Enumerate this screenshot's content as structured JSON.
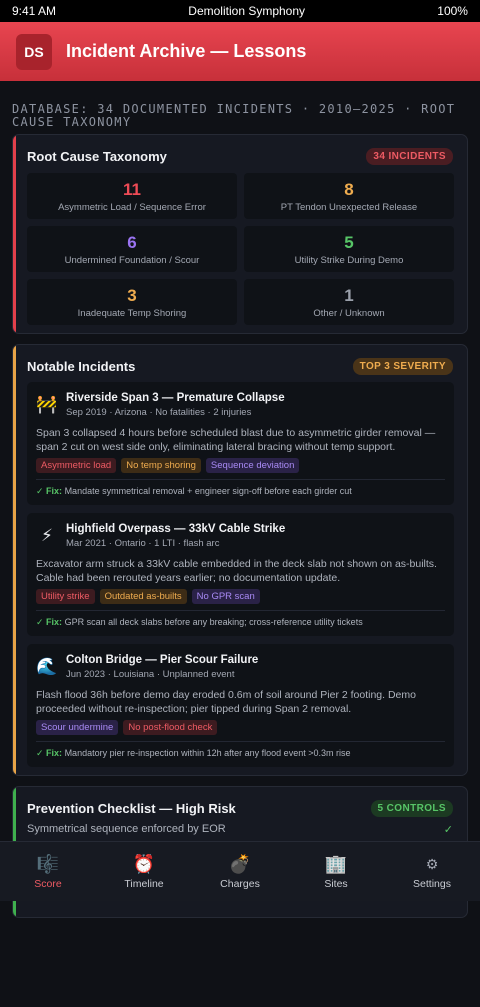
{
  "status_bar": {
    "time": "9:41 AM",
    "title": "Demolition Symphony",
    "battery": "100%"
  },
  "header": {
    "avatar": "DS",
    "title": "Incident Archive — Lessons"
  },
  "database_line": "DATABASE: 34 DOCUMENTED INCIDENTS · 2010–2025 · ROOT CAUSE TAXONOMY",
  "taxonomy": {
    "title": "Root Cause Taxonomy",
    "badge": "34 INCIDENTS",
    "cells": [
      {
        "value": "11",
        "label": "Asymmetric Load / Sequence Error",
        "color": "#ee4b56"
      },
      {
        "value": "8",
        "label": "PT Tendon Unexpected Release",
        "color": "#efac4f"
      },
      {
        "value": "6",
        "label": "Undermined Foundation / Scour",
        "color": "#9a73f2"
      },
      {
        "value": "5",
        "label": "Utility Strike During Demo",
        "color": "#57c567"
      },
      {
        "value": "3",
        "label": "Inadequate Temp Shoring",
        "color": "#efac4f"
      },
      {
        "value": "1",
        "label": "Other / Unknown",
        "color": "#9aa0ab"
      }
    ]
  },
  "notable": {
    "title": "Notable Incidents",
    "badge": "TOP 3 SEVERITY",
    "incidents": [
      {
        "icon": "🚧",
        "icon_name": "construction-barrier-icon",
        "title": "Riverside Span 3 — Premature Collapse",
        "meta": "Sep 2019 · Arizona · No fatalities · 2 injuries",
        "description": "Span 3 collapsed 4 hours before scheduled blast due to asymmetric girder removal — span 2 cut on west side only, eliminating lateral bracing without temp support.",
        "tags": [
          {
            "text": "Asymmetric load",
            "color": "red"
          },
          {
            "text": "No temp shoring",
            "color": "amber"
          },
          {
            "text": "Sequence deviation",
            "color": "purple"
          }
        ],
        "fix_label": "✓ Fix:",
        "fix_text": "Mandate symmetrical removal + engineer sign-off before each girder cut"
      },
      {
        "icon": "⚡",
        "icon_name": "lightning-icon",
        "title": "Highfield Overpass — 33kV Cable Strike",
        "meta": "Mar 2021 · Ontario · 1 LTI · flash arc",
        "description": "Excavator arm struck a 33kV cable embedded in the deck slab not shown on as-builts. Cable had been rerouted years earlier; no documentation update.",
        "tags": [
          {
            "text": "Utility strike",
            "color": "red"
          },
          {
            "text": "Outdated as-builts",
            "color": "amber"
          },
          {
            "text": "No GPR scan",
            "color": "purple"
          }
        ],
        "fix_label": "✓ Fix:",
        "fix_text": "GPR scan all deck slabs before any breaking; cross-reference utility tickets"
      },
      {
        "icon": "🌊",
        "icon_name": "wave-icon",
        "title": "Colton Bridge — Pier Scour Failure",
        "meta": "Jun 2023 · Louisiana · Unplanned event",
        "description": "Flash flood 36h before demo day eroded 0.6m of soil around Pier 2 footing. Demo proceeded without re-inspection; pier tipped during Span 2 removal.",
        "tags": [
          {
            "text": "Scour undermine",
            "color": "purple"
          },
          {
            "text": "No post-flood check",
            "color": "red"
          }
        ],
        "fix_label": "✓ Fix:",
        "fix_text": "Mandatory pier re-inspection within 12h after any flood event >0.3m rise"
      }
    ]
  },
  "checklist": {
    "title": "Prevention Checklist — High Risk",
    "badge": "5 CONTROLS",
    "first_item": "Symmetrical sequence enforced by EOR",
    "first_check": "✓"
  },
  "tabbar": [
    {
      "icon": "🎼",
      "icon_name": "score-icon",
      "label": "Score",
      "active": true
    },
    {
      "icon": "⏰",
      "icon_name": "alarm-clock-icon",
      "label": "Timeline",
      "active": false
    },
    {
      "icon": "💣",
      "icon_name": "bomb-icon",
      "label": "Charges",
      "active": false
    },
    {
      "icon": "🏢",
      "icon_name": "building-icon",
      "label": "Sites",
      "active": false
    },
    {
      "icon": "⚙",
      "icon_name": "gear-icon",
      "label": "Settings",
      "active": false
    }
  ]
}
